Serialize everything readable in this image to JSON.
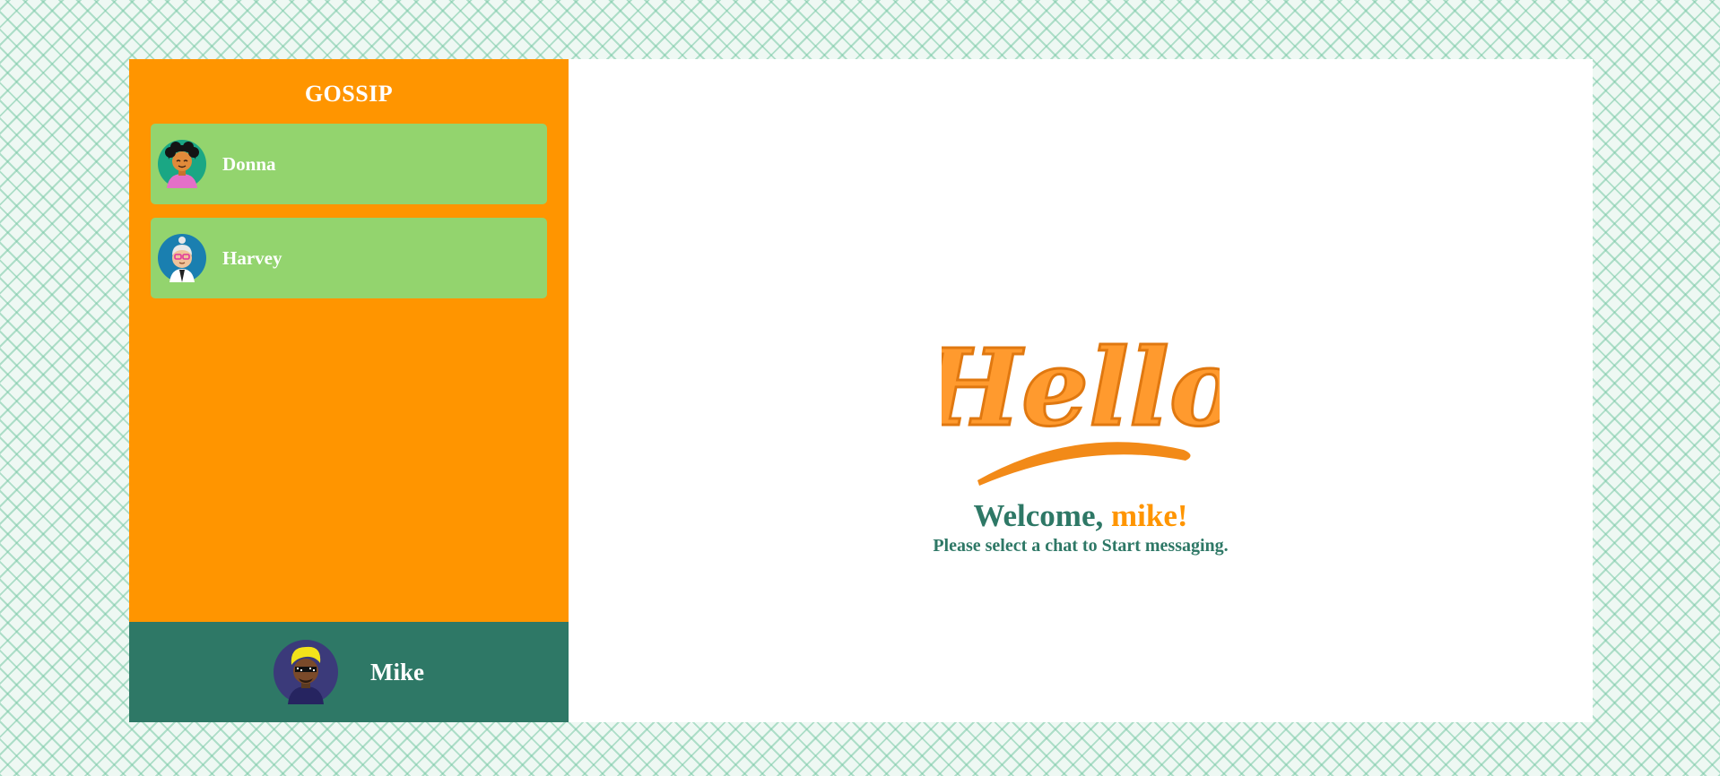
{
  "sidebar": {
    "brand": "GOSSIP",
    "chats": [
      {
        "name": "Donna",
        "avatar_icon": "donna-avatar-icon"
      },
      {
        "name": "Harvey",
        "avatar_icon": "harvey-avatar-icon"
      }
    ],
    "current_user": {
      "name": "Mike",
      "avatar_icon": "mike-avatar-icon"
    }
  },
  "main": {
    "logo_text": "Hello",
    "welcome_prefix": "Welcome,",
    "welcome_username": "mike!",
    "prompt": "Please select a chat to Start messaging."
  },
  "colors": {
    "sidebar": "#ff9500",
    "chat_item": "#93d46e",
    "user_bar": "#2e7866",
    "accent_text": "#2e7866",
    "username_text": "#ff9500"
  }
}
